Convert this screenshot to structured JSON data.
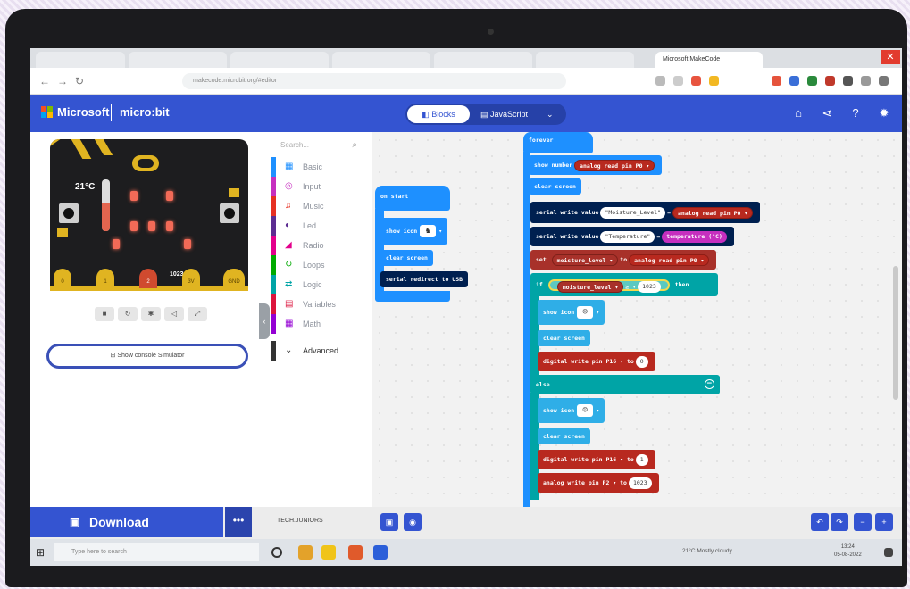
{
  "browser": {
    "tabs": [
      "",
      "",
      "",
      "",
      "",
      "",
      ""
    ],
    "active_tab": "Microsoft MakeCode",
    "url": "makecode.microbit.org/#editor"
  },
  "header": {
    "brand": "Microsoft",
    "product": "micro:bit",
    "blocks_label": "Blocks",
    "javascript_label": "JavaScript"
  },
  "simulator": {
    "temperature": "21°C",
    "temperature_fraction": 0.55,
    "light_level": "1023",
    "pins": [
      "0",
      "1",
      "2",
      "3V",
      "GND"
    ],
    "show_console": "Show console Simulator"
  },
  "toolbox": {
    "search_placeholder": "Search...",
    "categories": [
      {
        "label": "Basic",
        "color": "#1e90ff",
        "icon": "grid-icon",
        "glyph": "▦"
      },
      {
        "label": "Input",
        "color": "#c62fbf",
        "icon": "target-icon",
        "glyph": "◎"
      },
      {
        "label": "Music",
        "color": "#e63022",
        "icon": "headphones-icon",
        "glyph": "♫"
      },
      {
        "label": "Led",
        "color": "#5c2d91",
        "icon": "toggle-icon",
        "glyph": "◐"
      },
      {
        "label": "Radio",
        "color": "#e3008c",
        "icon": "signal-icon",
        "glyph": "◢"
      },
      {
        "label": "Loops",
        "color": "#00aa00",
        "icon": "refresh-icon",
        "glyph": "↻"
      },
      {
        "label": "Logic",
        "color": "#00a4a6",
        "icon": "shuffle-icon",
        "glyph": "⇄"
      },
      {
        "label": "Variables",
        "color": "#dc143c",
        "icon": "list-icon",
        "glyph": "▤"
      },
      {
        "label": "Math",
        "color": "#9400d3",
        "icon": "calculator-icon",
        "glyph": "▦"
      },
      {
        "label": "Advanced",
        "color": "#333333",
        "icon": "chevron-down-icon",
        "glyph": "⌄"
      }
    ]
  },
  "workspace": {
    "on_start": {
      "label": "on start",
      "show_icon": "show icon",
      "clear_screen": "clear screen",
      "serial_redirect": "serial redirect to USB"
    },
    "forever": {
      "label": "forever",
      "show_number": "show number",
      "analog_read_p0": "analog read pin P0 ▾",
      "clear_screen": "clear screen",
      "serial_write_value": "serial write value",
      "moisture_string": "\"Moisture_Level\"",
      "temperature_string": "\"Temperature\"",
      "temperature_reporter": "temperature (°C)",
      "set": "set",
      "moisture_var": "moisture_level ▾",
      "to": "to",
      "if": "if",
      "op": "≥ ▾",
      "threshold": "1023",
      "then": "then",
      "show_icon": "show icon",
      "digital_write_pin": "digital write pin",
      "p16": "P16 ▾",
      "zero": "0",
      "else": "else",
      "one": "1",
      "analog_write_pin": "analog write pin",
      "p2": "P2 ▾",
      "value_1023": "1023"
    }
  },
  "footer": {
    "download": "Download",
    "project_name": "TECH.JUNIORS"
  },
  "taskbar": {
    "search": "Type here to search",
    "weather": "21°C Mostly cloudy",
    "time": "13:24",
    "date": "05-08-2022"
  }
}
